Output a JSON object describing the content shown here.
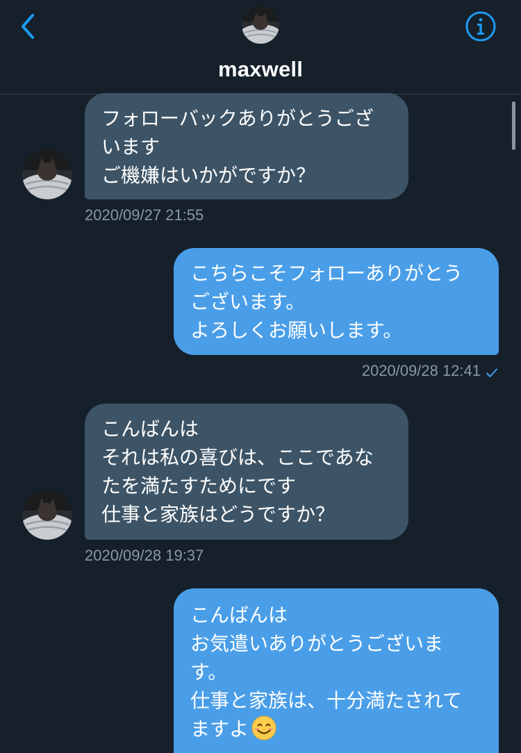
{
  "header": {
    "title": "maxwell",
    "back_icon": "chevron-left-icon",
    "info_icon": "info-icon",
    "accent_color": "#1d9bf0"
  },
  "messages": [
    {
      "direction": "incoming",
      "lines": [
        "フォローバックありがとうござ",
        "います",
        "ご機嫌はいかがですか？"
      ],
      "timestamp": "2020/09/27 21:55"
    },
    {
      "direction": "outgoing",
      "lines": [
        "こちらこそフォローありがとう",
        "ございます。",
        "よろしくお願いします。"
      ],
      "timestamp": "2020/09/28 12:41",
      "status_icon": "read-check-icon"
    },
    {
      "direction": "incoming",
      "lines": [
        "こんばんは",
        "それは私の喜びは、ここであな",
        "たを満たすためにです",
        "仕事と家族はどうですか？"
      ],
      "timestamp": "2020/09/28 19:37"
    },
    {
      "direction": "outgoing",
      "lines": [
        "こんばんは",
        "お気遣いありがとうございま",
        "す。",
        "仕事と家族は、十分満たされて",
        "ますよ"
      ],
      "trailing_emoji": "smiling-face-emoji"
    }
  ]
}
